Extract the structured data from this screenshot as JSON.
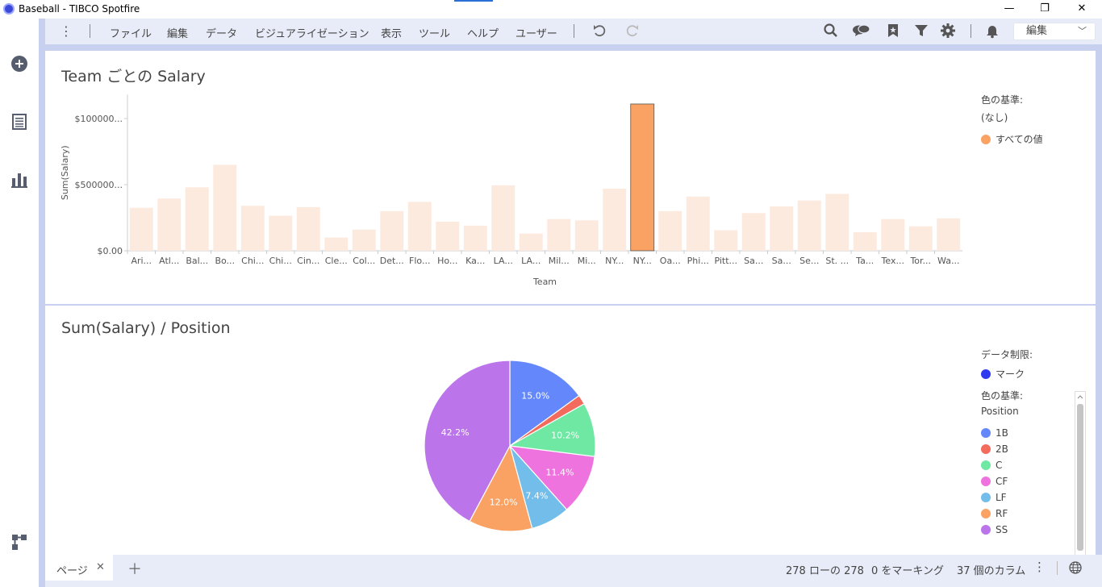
{
  "window": {
    "title": "Baseball - TIBCO Spotfire",
    "minimize": "—",
    "restore": "❐",
    "close": "✕"
  },
  "menu": {
    "items": [
      "ファイル",
      "編集",
      "データ",
      "ビジュアライゼーション",
      "表示",
      "ツール",
      "ヘルプ",
      "ユーザー"
    ],
    "edit_dropdown": "編集"
  },
  "bar_viz": {
    "title": "Team ごとの Salary",
    "legend_title": "色の基準:",
    "legend_none": "(なし)",
    "legend_item": "すべての値",
    "colors": {
      "bar": "#fdeadf",
      "highlight": "#f9a263"
    }
  },
  "pie_viz": {
    "title": "Sum(Salary) / Position",
    "limit_title": "データ制限:",
    "mark_label": "マーク",
    "mark_color": "#2f3af0",
    "color_by_title": "色の基準:",
    "color_by_value": "Position"
  },
  "chart_data": [
    {
      "type": "bar",
      "title": "Team ごとの Salary",
      "xlabel": "Team",
      "ylabel": "Sum(Salary)",
      "y_tick_labels": [
        "$0.00",
        "$500000...",
        "$100000..."
      ],
      "y_ticks": [
        0,
        5000000,
        10000000
      ],
      "ylim": [
        0,
        11800000
      ],
      "grid": false,
      "legend_position": "right",
      "categories": [
        "Ari...",
        "Atl...",
        "Bal...",
        "Bo...",
        "Chi...",
        "Chi...",
        "Cin...",
        "Cle...",
        "Col...",
        "Det...",
        "Flo...",
        "Ho...",
        "Ka...",
        "LA...",
        "LA...",
        "Mil...",
        "Mi...",
        "NY...",
        "NY...",
        "Oa...",
        "Phi...",
        "Pitt...",
        "Sa...",
        "Sa...",
        "Se...",
        "St. ...",
        "Ta...",
        "Tex...",
        "Tor...",
        "Wa..."
      ],
      "values": [
        3250000,
        3950000,
        4800000,
        6500000,
        3400000,
        2650000,
        3300000,
        1000000,
        1600000,
        3000000,
        3700000,
        2200000,
        1900000,
        4950000,
        1300000,
        2400000,
        2300000,
        4700000,
        11100000,
        3000000,
        4100000,
        1550000,
        2850000,
        3350000,
        3800000,
        4300000,
        1400000,
        2400000,
        1850000,
        2450000
      ],
      "highlight_index": 18
    },
    {
      "type": "pie",
      "title": "Sum(Salary) / Position",
      "legend_position": "right",
      "slices": [
        {
          "label": "1B",
          "value": 15.0,
          "color": "#6488fb",
          "text": "15.0%"
        },
        {
          "label": "2B",
          "value": 1.8,
          "color": "#f26b5c",
          "text": ""
        },
        {
          "label": "C",
          "value": 10.2,
          "color": "#6fe8a4",
          "text": "10.2%"
        },
        {
          "label": "CF",
          "value": 11.4,
          "color": "#ef73de",
          "text": "11.4%"
        },
        {
          "label": "LF",
          "value": 7.4,
          "color": "#73bdeb",
          "text": "7.4%"
        },
        {
          "label": "RF",
          "value": 12.0,
          "color": "#f9a263",
          "text": "12.0%"
        },
        {
          "label": "SS",
          "value": 42.2,
          "color": "#bb74ea",
          "text": "42.2%"
        }
      ]
    }
  ],
  "status": {
    "page_tab": "ページ",
    "rows": "278 ローの 278",
    "marked": "0 をマーキング",
    "columns": "37 個のカラム"
  }
}
